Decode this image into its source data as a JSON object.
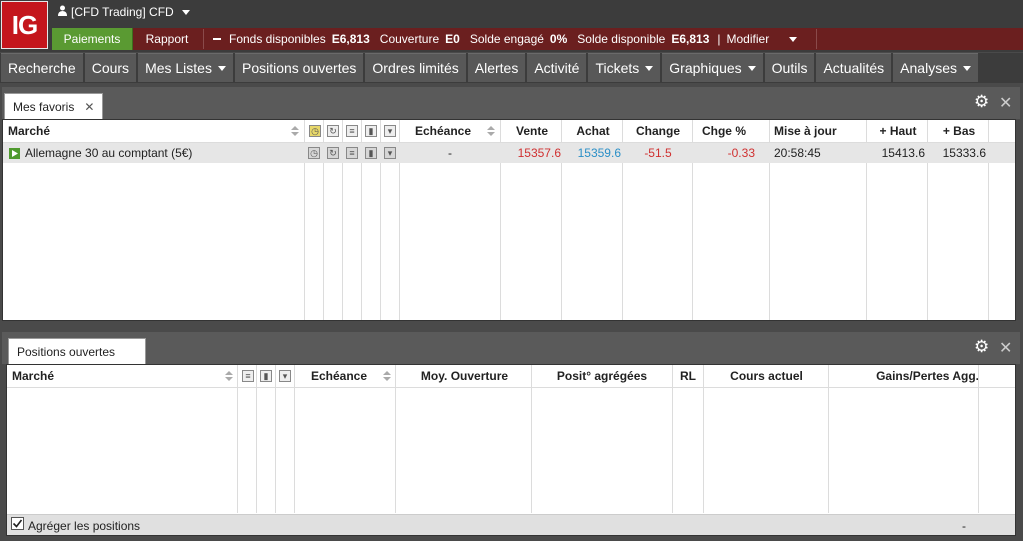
{
  "app": {
    "logo": "IG",
    "account_label": "[CFD Trading] CFD"
  },
  "funds": {
    "payments_label": "Paiements",
    "report_label": "Rapport",
    "available_funds_label": "Fonds disponibles",
    "available_funds_value": "E6,813",
    "margin_label": "Couverture",
    "margin_value": "E0",
    "committed_label": "Solde engagé",
    "committed_value": "0%",
    "available_balance_label": "Solde disponible",
    "available_balance_value": "E6,813",
    "modify_label": "Modifier"
  },
  "nav": {
    "items": [
      {
        "label": "Recherche",
        "dropdown": false
      },
      {
        "label": "Cours",
        "dropdown": false
      },
      {
        "label": "Mes Listes",
        "dropdown": true
      },
      {
        "label": "Positions ouvertes",
        "dropdown": false
      },
      {
        "label": "Ordres limités",
        "dropdown": false
      },
      {
        "label": "Alertes",
        "dropdown": false
      },
      {
        "label": "Activité",
        "dropdown": false
      },
      {
        "label": "Tickets",
        "dropdown": true
      },
      {
        "label": "Graphiques",
        "dropdown": true
      },
      {
        "label": "Outils",
        "dropdown": false
      },
      {
        "label": "Actualités",
        "dropdown": false
      },
      {
        "label": "Analyses",
        "dropdown": true
      }
    ]
  },
  "favorites": {
    "tab_label": "Mes favoris",
    "columns": {
      "market": "Marché",
      "expiry": "Echéance",
      "sell": "Vente",
      "buy": "Achat",
      "change": "Change",
      "change_pct": "Chge %",
      "updated": "Mise à jour",
      "high": "+ Haut",
      "low": "+ Bas"
    },
    "rows": [
      {
        "market": "Allemagne 30 au comptant (5€)",
        "expiry": "-",
        "sell": "15357.6",
        "buy": "15359.6",
        "change": "-51.5",
        "change_pct": "-0.33",
        "updated": "20:58:45",
        "high": "15413.6",
        "low": "15333.6"
      }
    ]
  },
  "positions": {
    "tab_label": "Positions ouvertes",
    "columns": {
      "market": "Marché",
      "expiry": "Echéance",
      "avg_open": "Moy. Ouverture",
      "aggregated": "Posit° agrégées",
      "rl": "RL",
      "current": "Cours actuel",
      "pnl": "Gains/Pertes Agg."
    },
    "aggregate_label": "Agréger les positions",
    "aggregate_checked": true,
    "footer_total": "-"
  },
  "colors": {
    "brand_red": "#c4161c",
    "pay_green": "#5a9a32",
    "sell_red": "#d03030",
    "buy_blue": "#2a8fc7"
  }
}
